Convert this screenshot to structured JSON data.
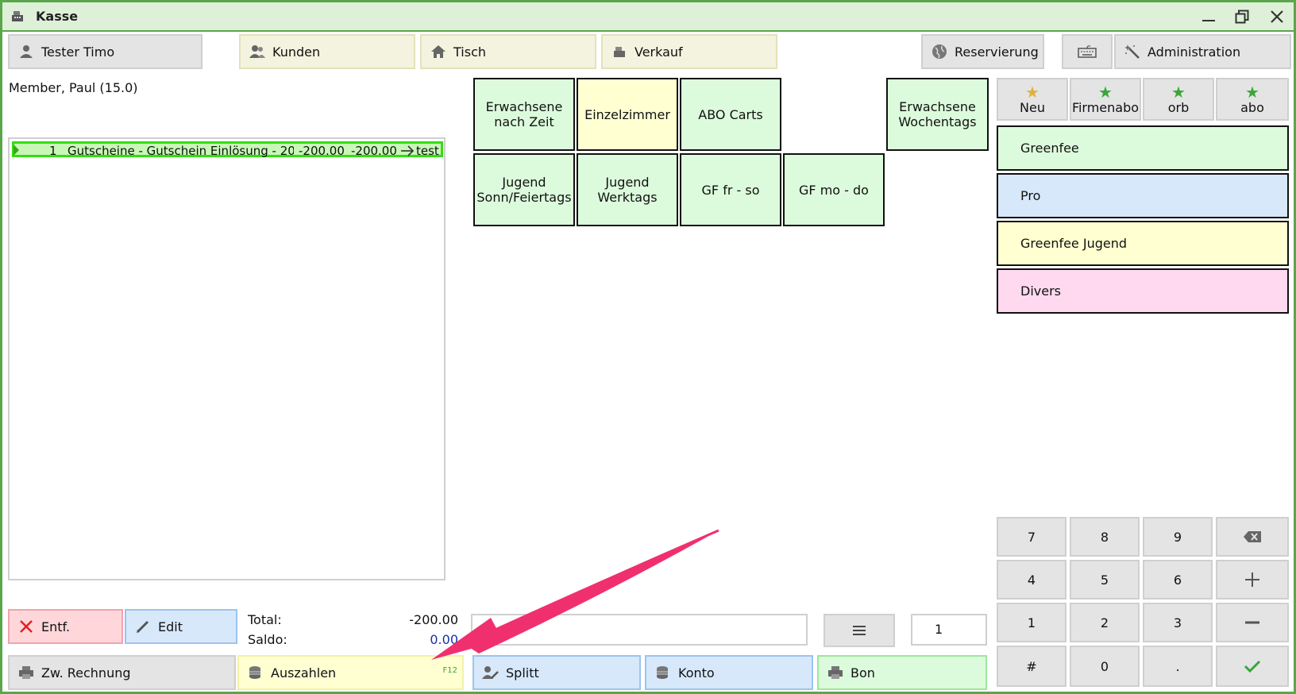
{
  "window": {
    "title": "Kasse"
  },
  "topbar": {
    "user": "Tester Timo",
    "kunden": "Kunden",
    "tisch": "Tisch",
    "verkauf": "Verkauf",
    "reservierung": "Reservierung",
    "administration": "Administration"
  },
  "customer": {
    "name": "Member, Paul (15.0)"
  },
  "order_rows": [
    {
      "qty": "1",
      "description": "Gutscheine - Gutschein Einlösung - 20...",
      "price": "-200.00",
      "total": "-200.00",
      "target": "test"
    }
  ],
  "products": [
    "Erwachsene nach Zeit",
    "Einzelzimmer",
    "ABO Carts",
    "Erwachsene Wochentags",
    "Jugend Sonn/Feiertags",
    "Jugend Werktags",
    "GF fr - so",
    "GF mo - do"
  ],
  "favorites": [
    "Neu",
    "Firmenabo",
    "orb",
    "abo"
  ],
  "categories": [
    "Greenfee",
    "Pro",
    "Greenfee Jugend",
    "Divers"
  ],
  "keypad": [
    "7",
    "8",
    "9",
    "4",
    "5",
    "6",
    "1",
    "2",
    "3",
    "#",
    "0",
    "."
  ],
  "actions": {
    "remove": "Entf.",
    "edit": "Edit",
    "interim_invoice": "Zw. Rechnung",
    "pay": "Auszahlen",
    "pay_shortcut": "F12",
    "split": "Splitt",
    "account": "Konto",
    "receipt": "Bon"
  },
  "totals": {
    "total_label": "Total:",
    "total_value": "-200.00",
    "saldo_label": "Saldo:",
    "saldo_value": "0.00"
  },
  "quantity_field": {
    "value": "1"
  },
  "search_field": {
    "value": ""
  },
  "colors": {
    "accent_green": "#5aa64a",
    "row_highlight": "#33dd11",
    "saldo_blue": "#1a2fb0",
    "arrow_pink": "#f0306e",
    "fav_star_gold": "#e0b040",
    "fav_star_green": "#3aa63a"
  }
}
